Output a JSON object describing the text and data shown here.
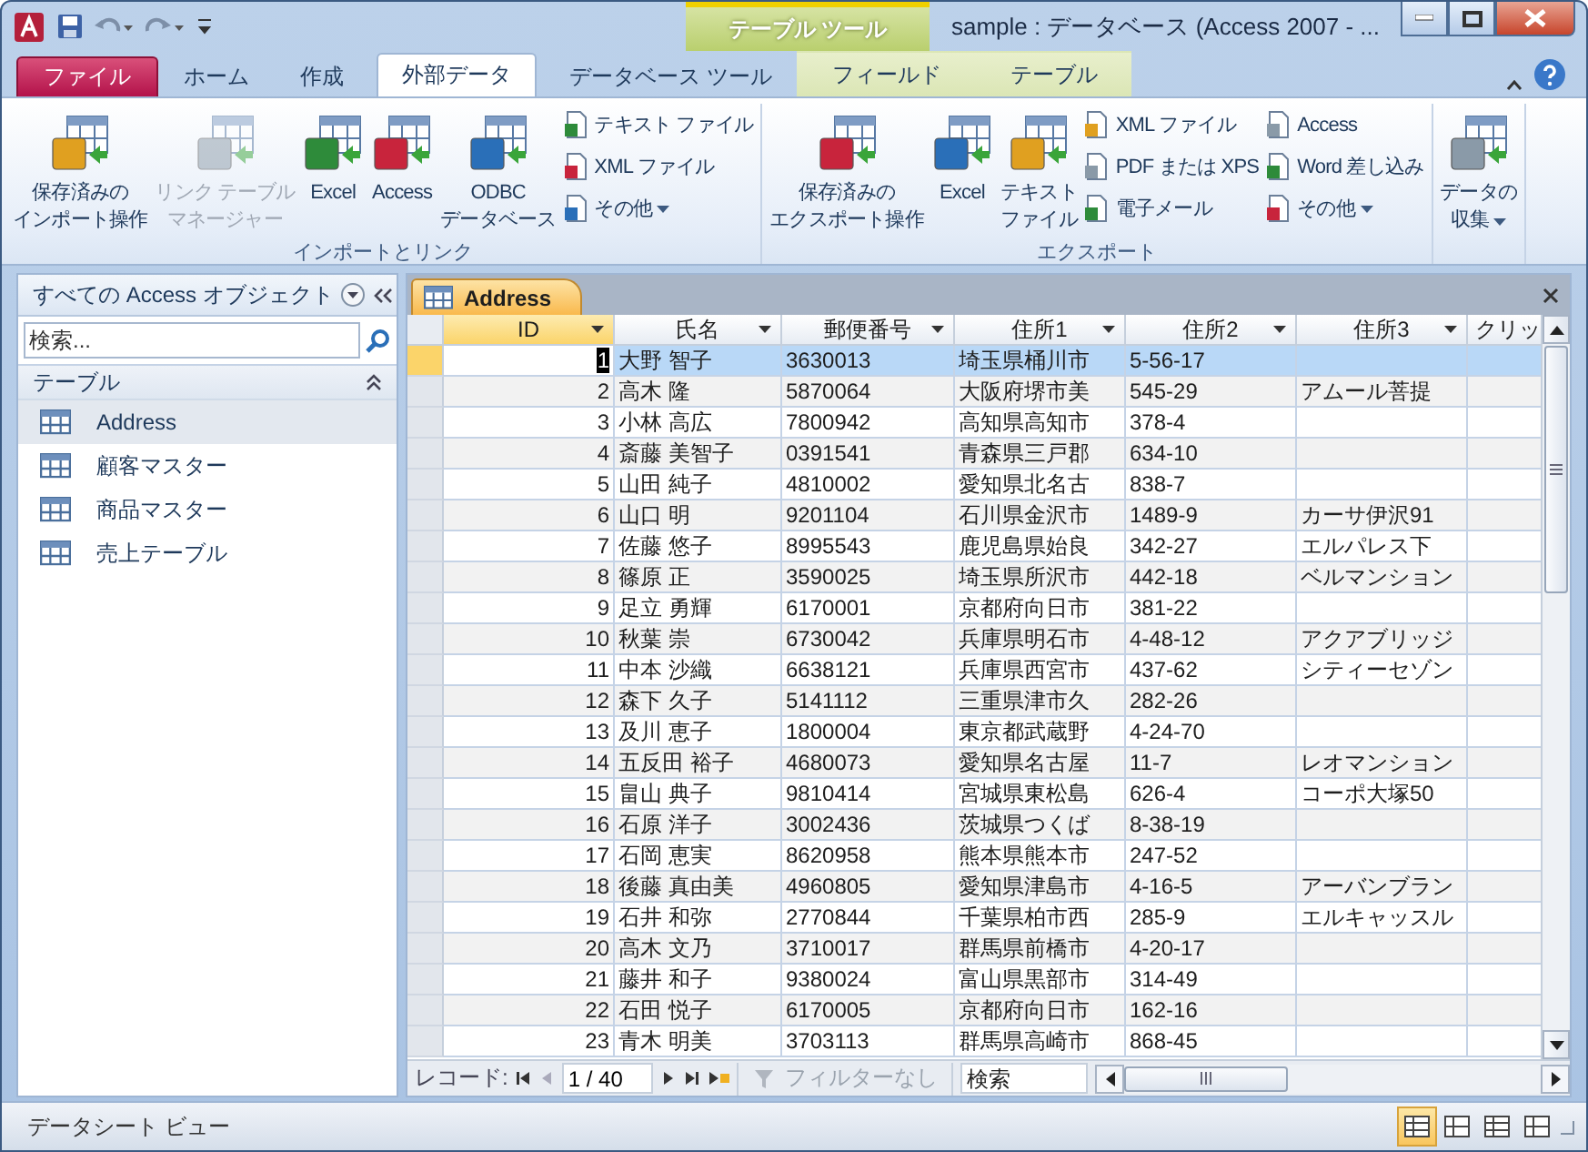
{
  "window": {
    "title": "sample : データベース (Access 2007 - ...",
    "context_label": "テーブル ツール"
  },
  "ribbon_tabs": [
    {
      "label": "ファイル",
      "kind": "file",
      "selected": false
    },
    {
      "label": "ホーム",
      "kind": "normal",
      "selected": false
    },
    {
      "label": "作成",
      "kind": "normal",
      "selected": false
    },
    {
      "label": "外部データ",
      "kind": "normal",
      "selected": true
    },
    {
      "label": "データベース ツール",
      "kind": "normal",
      "selected": false
    },
    {
      "label": "フィールド",
      "kind": "context",
      "selected": false
    },
    {
      "label": "テーブル",
      "kind": "context",
      "selected": false
    }
  ],
  "ribbon_groups": [
    {
      "label": "インポートとリンク",
      "columns": [
        {
          "kind": "large",
          "lines": [
            "保存済みの",
            "インポート操作"
          ],
          "disabled": false
        },
        {
          "kind": "large",
          "lines": [
            "リンク テーブル",
            "マネージャー"
          ],
          "disabled": true
        },
        {
          "kind": "large",
          "lines": [
            "Excel"
          ],
          "disabled": false
        },
        {
          "kind": "large",
          "lines": [
            "Access"
          ],
          "disabled": false
        },
        {
          "kind": "large",
          "lines": [
            "ODBC",
            "データベース"
          ],
          "disabled": false
        },
        {
          "kind": "stack",
          "items": [
            {
              "label": "テキスト ファイル"
            },
            {
              "label": "XML ファイル"
            },
            {
              "label": "その他",
              "dropdown": true
            }
          ]
        }
      ]
    },
    {
      "label": "エクスポート",
      "columns": [
        {
          "kind": "large",
          "lines": [
            "保存済みの",
            "エクスポート操作"
          ],
          "disabled": false
        },
        {
          "kind": "large",
          "lines": [
            "Excel"
          ],
          "disabled": false
        },
        {
          "kind": "large",
          "lines": [
            "テキスト",
            "ファイル"
          ],
          "disabled": false
        },
        {
          "kind": "stack",
          "items": [
            {
              "label": "XML ファイル"
            },
            {
              "label": "PDF または XPS"
            },
            {
              "label": "電子メール"
            }
          ]
        },
        {
          "kind": "stack",
          "items": [
            {
              "label": "Access"
            },
            {
              "label": "Word 差し込み"
            },
            {
              "label": "その他",
              "dropdown": true
            }
          ]
        }
      ]
    },
    {
      "columns": [
        {
          "kind": "large",
          "lines": [
            "データの",
            "収集"
          ],
          "disabled": false,
          "dropdown": true
        }
      ]
    }
  ],
  "nav_pane": {
    "title": "すべての Access オブジェクト",
    "search_placeholder": "検索...",
    "group": "テーブル",
    "items": [
      {
        "label": "Address",
        "selected": true
      },
      {
        "label": "顧客マスター",
        "selected": false
      },
      {
        "label": "商品マスター",
        "selected": false
      },
      {
        "label": "売上テーブル",
        "selected": false
      }
    ]
  },
  "document_tab": {
    "label": "Address",
    "selected": true
  },
  "table": {
    "columns": [
      {
        "label": "ID",
        "kind": "number",
        "selected": true,
        "dropdown": true
      },
      {
        "label": "氏名",
        "kind": "text",
        "selected": false,
        "dropdown": true
      },
      {
        "label": "郵便番号",
        "kind": "text",
        "selected": false,
        "dropdown": true
      },
      {
        "label": "住所1",
        "kind": "text",
        "selected": false,
        "dropdown": true
      },
      {
        "label": "住所2",
        "kind": "text",
        "selected": false,
        "dropdown": true
      },
      {
        "label": "住所3",
        "kind": "text",
        "selected": false,
        "dropdown": true
      },
      {
        "label": "クリッ",
        "kind": "text",
        "selected": false,
        "dropdown": false
      }
    ],
    "rows": [
      {
        "selected": true,
        "cells": [
          "1",
          "大野 智子",
          "3630013",
          "埼玉県桶川市",
          "5-56-17",
          "",
          ""
        ]
      },
      {
        "selected": false,
        "cells": [
          "2",
          "高木 隆",
          "5870064",
          "大阪府堺市美",
          "545-29",
          "アムール菩提",
          ""
        ]
      },
      {
        "selected": false,
        "cells": [
          "3",
          "小林 高広",
          "7800942",
          "高知県高知市",
          "378-4",
          "",
          ""
        ]
      },
      {
        "selected": false,
        "cells": [
          "4",
          "斎藤 美智子",
          "0391541",
          "青森県三戸郡",
          "634-10",
          "",
          ""
        ]
      },
      {
        "selected": false,
        "cells": [
          "5",
          "山田 純子",
          "4810002",
          "愛知県北名古",
          "838-7",
          "",
          ""
        ]
      },
      {
        "selected": false,
        "cells": [
          "6",
          "山口 明",
          "9201104",
          "石川県金沢市",
          "1489-9",
          "カーサ伊沢91",
          ""
        ]
      },
      {
        "selected": false,
        "cells": [
          "7",
          "佐藤 悠子",
          "8995543",
          "鹿児島県始良",
          "342-27",
          "エルパレス下",
          ""
        ]
      },
      {
        "selected": false,
        "cells": [
          "8",
          "篠原 正",
          "3590025",
          "埼玉県所沢市",
          "442-18",
          "ベルマンション",
          ""
        ]
      },
      {
        "selected": false,
        "cells": [
          "9",
          "足立 勇輝",
          "6170001",
          "京都府向日市",
          "381-22",
          "",
          ""
        ]
      },
      {
        "selected": false,
        "cells": [
          "10",
          "秋葉 崇",
          "6730042",
          "兵庫県明石市",
          "4-48-12",
          "アクアブリッジ",
          ""
        ]
      },
      {
        "selected": false,
        "cells": [
          "11",
          "中本 沙織",
          "6638121",
          "兵庫県西宮市",
          "437-62",
          "シティーセゾン",
          ""
        ]
      },
      {
        "selected": false,
        "cells": [
          "12",
          "森下 久子",
          "5141112",
          "三重県津市久",
          "282-26",
          "",
          ""
        ]
      },
      {
        "selected": false,
        "cells": [
          "13",
          "及川 恵子",
          "1800004",
          "東京都武蔵野",
          "4-24-70",
          "",
          ""
        ]
      },
      {
        "selected": false,
        "cells": [
          "14",
          "五反田 裕子",
          "4680073",
          "愛知県名古屋",
          "11-7",
          "レオマンション",
          ""
        ]
      },
      {
        "selected": false,
        "cells": [
          "15",
          "畠山 典子",
          "9810414",
          "宮城県東松島",
          "626-4",
          "コーポ大塚50",
          ""
        ]
      },
      {
        "selected": false,
        "cells": [
          "16",
          "石原 洋子",
          "3002436",
          "茨城県つくば",
          "8-38-19",
          "",
          ""
        ]
      },
      {
        "selected": false,
        "cells": [
          "17",
          "石岡 恵実",
          "8620958",
          "熊本県熊本市",
          "247-52",
          "",
          ""
        ]
      },
      {
        "selected": false,
        "cells": [
          "18",
          "後藤 真由美",
          "4960805",
          "愛知県津島市",
          "4-16-5",
          "アーバンブラン",
          ""
        ]
      },
      {
        "selected": false,
        "cells": [
          "19",
          "石井 和弥",
          "2770844",
          "千葉県柏市西",
          "285-9",
          "エルキャッスル",
          ""
        ]
      },
      {
        "selected": false,
        "cells": [
          "20",
          "高木 文乃",
          "3710017",
          "群馬県前橋市",
          "4-20-17",
          "",
          ""
        ]
      },
      {
        "selected": false,
        "cells": [
          "21",
          "藤井 和子",
          "9380024",
          "富山県黒部市",
          "314-49",
          "",
          ""
        ]
      },
      {
        "selected": false,
        "cells": [
          "22",
          "石田 悦子",
          "6170005",
          "京都府向日市",
          "162-16",
          "",
          ""
        ]
      },
      {
        "selected": false,
        "cells": [
          "23",
          "青木 明美",
          "3703113",
          "群馬県高崎市",
          "868-45",
          "",
          ""
        ]
      }
    ]
  },
  "record_nav": {
    "label": "レコード:",
    "position": "1 / 40",
    "filter": "フィルターなし",
    "filter_disabled": true,
    "search_placeholder": "検索"
  },
  "status_bar": {
    "text": "データシート ビュー",
    "views": [
      {
        "selected": true
      },
      {
        "selected": false
      },
      {
        "selected": false
      },
      {
        "selected": false
      }
    ]
  }
}
